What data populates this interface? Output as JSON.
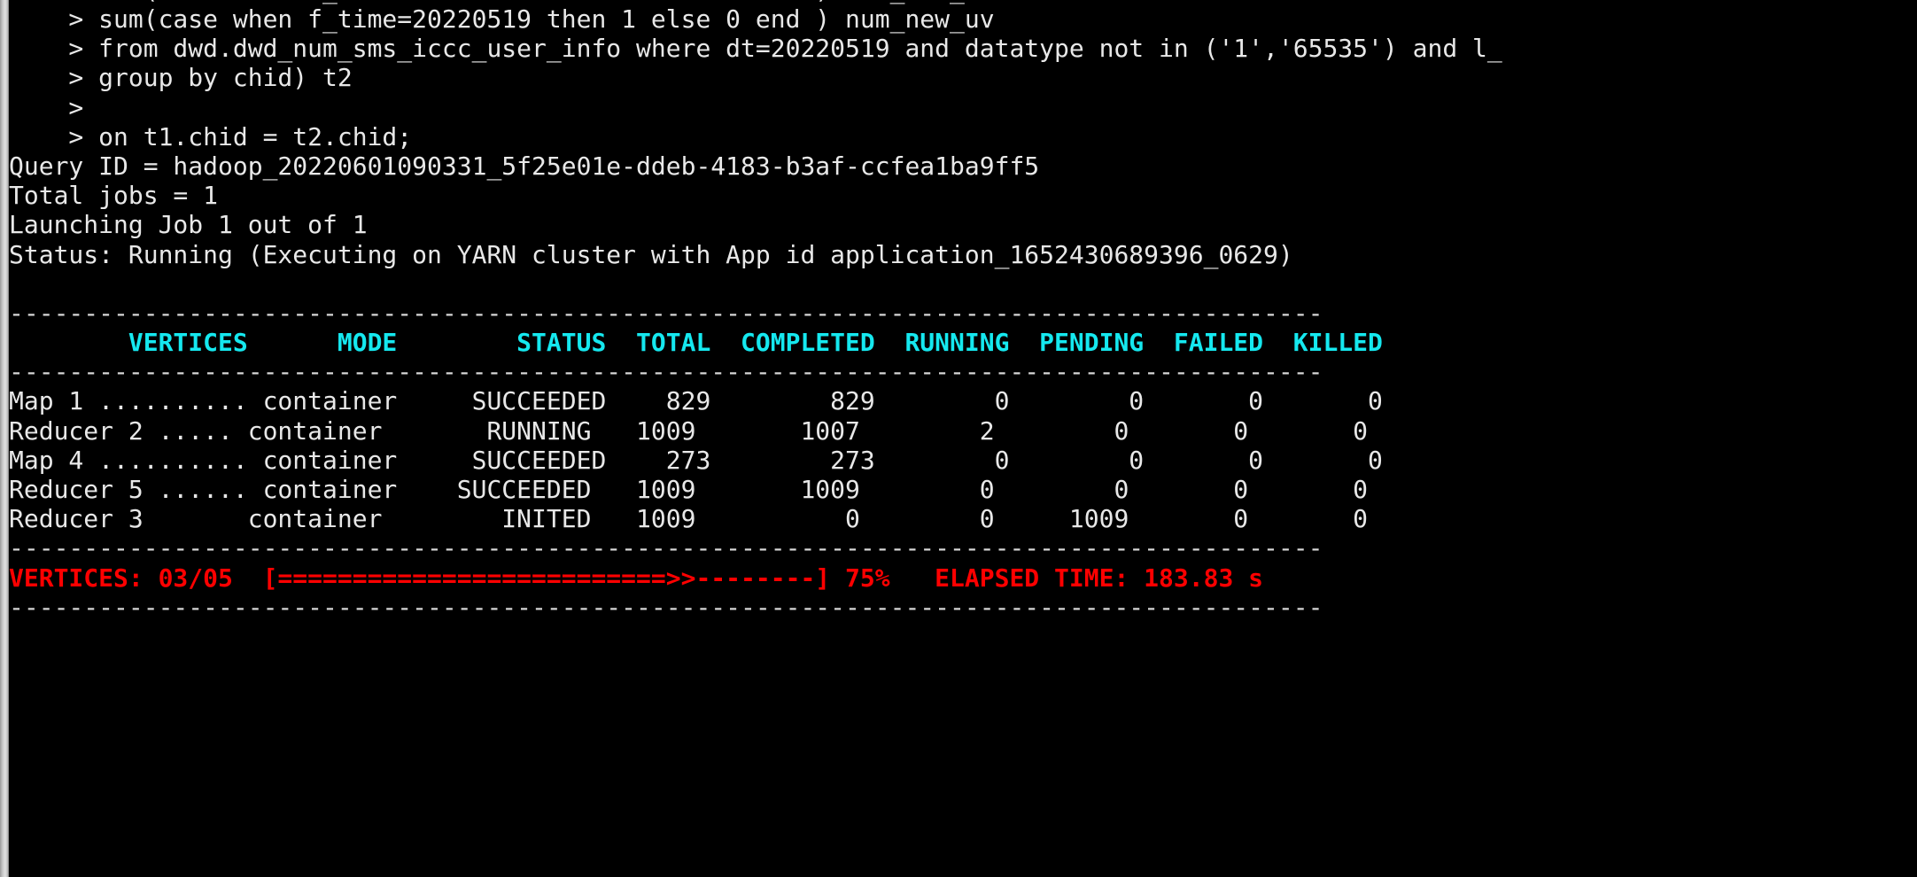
{
  "terminal": {
    "shell_prompt": ">",
    "colors": {
      "background": "#000000",
      "foreground": "#e8e8e8",
      "header_cyan": "#15e8ef",
      "progress_red": "#ff0000",
      "separator": "#d8d8d8"
    }
  },
  "query_lines": [
    "    > sum(case when f_time=20220519 then 1 else 0 end ) num_new_uv",
    "    > from dwd.dwd_num_sms_iccc_user_info where dt=20220519 and datatype not in ('1','65535') and l_",
    "    > group by chid) t2",
    "    >",
    "    > on t1.chid = t2.chid;"
  ],
  "job_info": {
    "query_id_line": "Query ID = hadoop_20220601090331_5f25e01e-ddeb-4183-b3af-ccfea1ba9ff5",
    "query_id": "hadoop_20220601090331_5f25e01e-ddeb-4183-b3af-ccfea1ba9ff5",
    "total_jobs_line": "Total jobs = 1",
    "total_jobs": "1",
    "launching_line": "Launching Job 1 out of 1",
    "status_line": "Status: Running (Executing on YARN cluster with App id application_1652430689396_0629)",
    "status": "Running",
    "app_id": "application_1652430689396_0629"
  },
  "separator_line": "----------------------------------------------------------------------------------------",
  "vertices_table": {
    "header_line": "        VERTICES      MODE        STATUS  TOTAL  COMPLETED  RUNNING  PENDING  FAILED  KILLED",
    "columns": [
      "VERTICES",
      "MODE",
      "STATUS",
      "TOTAL",
      "COMPLETED",
      "RUNNING",
      "PENDING",
      "FAILED",
      "KILLED"
    ],
    "rows": [
      {
        "line": "Map 1 .......... container     SUCCEEDED    829        829        0        0       0       0",
        "vertex": "Map 1",
        "dots": "..........",
        "mode": "container",
        "status": "SUCCEEDED",
        "total": "829",
        "completed": "829",
        "running": "0",
        "pending": "0",
        "failed": "0",
        "killed": "0"
      },
      {
        "line": "Reducer 2 ..... container       RUNNING   1009       1007        2        0       0       0",
        "vertex": "Reducer 2",
        "dots": ".....",
        "mode": "container",
        "status": "RUNNING",
        "total": "1009",
        "completed": "1007",
        "running": "2",
        "pending": "0",
        "failed": "0",
        "killed": "0"
      },
      {
        "line": "Map 4 .......... container     SUCCEEDED    273        273        0        0       0       0",
        "vertex": "Map 4",
        "dots": "..........",
        "mode": "container",
        "status": "SUCCEEDED",
        "total": "273",
        "completed": "273",
        "running": "0",
        "pending": "0",
        "failed": "0",
        "killed": "0"
      },
      {
        "line": "Reducer 5 ...... container    SUCCEEDED   1009       1009        0        0       0       0",
        "vertex": "Reducer 5",
        "dots": "......",
        "mode": "container",
        "status": "SUCCEEDED",
        "total": "1009",
        "completed": "1009",
        "running": "0",
        "pending": "0",
        "failed": "0",
        "killed": "0"
      },
      {
        "line": "Reducer 3       container        INITED   1009          0        0     1009       0       0",
        "vertex": "Reducer 3",
        "dots": "",
        "mode": "container",
        "status": "INITED",
        "total": "1009",
        "completed": "0",
        "running": "0",
        "pending": "1009",
        "failed": "0",
        "killed": "0"
      }
    ]
  },
  "progress": {
    "line": "VERTICES: 03/05  [==========================>>--------] 75%   ELAPSED TIME: 183.83 s",
    "label": "VERTICES:",
    "vertices_done": "03",
    "vertices_total": "05",
    "vertices_ratio": "03/05",
    "bar_open": "[",
    "bar_filled": "==========================",
    "bar_arrow": ">>",
    "bar_empty": "--------",
    "bar_close": "]",
    "percent": "75%",
    "percent_value": 75,
    "elapsed_label": "ELAPSED TIME:",
    "elapsed_value": "183.83",
    "elapsed_unit": "s",
    "elapsed_text": "ELAPSED TIME: 183.83 s"
  }
}
